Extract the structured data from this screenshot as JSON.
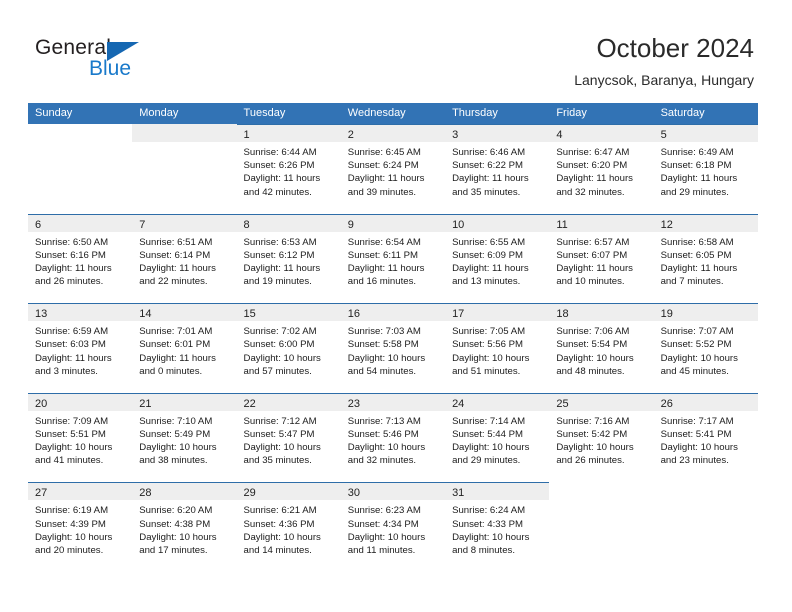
{
  "brand": {
    "name_part1": "General",
    "name_part2": "Blue",
    "color_dark": "#231f20",
    "color_blue": "#1979ca"
  },
  "header": {
    "title": "October 2024",
    "subtitle": "Lanycsok, Baranya, Hungary"
  },
  "theme": {
    "header_blue": "#3273b5",
    "separator_blue": "#2e6da8",
    "date_strip_gray": "#eeeeee"
  },
  "weekdays": [
    "Sunday",
    "Monday",
    "Tuesday",
    "Wednesday",
    "Thursday",
    "Friday",
    "Saturday"
  ],
  "weeks": [
    [
      {
        "day": "",
        "sunrise": "",
        "sunset": "",
        "daylight": "",
        "state": "blank"
      },
      {
        "day": "",
        "sunrise": "",
        "sunset": "",
        "daylight": "",
        "state": "empty"
      },
      {
        "day": "1",
        "sunrise": "Sunrise: 6:44 AM",
        "sunset": "Sunset: 6:26 PM",
        "daylight": "Daylight: 11 hours and 42 minutes.",
        "state": "filled"
      },
      {
        "day": "2",
        "sunrise": "Sunrise: 6:45 AM",
        "sunset": "Sunset: 6:24 PM",
        "daylight": "Daylight: 11 hours and 39 minutes.",
        "state": "filled"
      },
      {
        "day": "3",
        "sunrise": "Sunrise: 6:46 AM",
        "sunset": "Sunset: 6:22 PM",
        "daylight": "Daylight: 11 hours and 35 minutes.",
        "state": "filled"
      },
      {
        "day": "4",
        "sunrise": "Sunrise: 6:47 AM",
        "sunset": "Sunset: 6:20 PM",
        "daylight": "Daylight: 11 hours and 32 minutes.",
        "state": "filled"
      },
      {
        "day": "5",
        "sunrise": "Sunrise: 6:49 AM",
        "sunset": "Sunset: 6:18 PM",
        "daylight": "Daylight: 11 hours and 29 minutes.",
        "state": "filled"
      }
    ],
    [
      {
        "day": "6",
        "sunrise": "Sunrise: 6:50 AM",
        "sunset": "Sunset: 6:16 PM",
        "daylight": "Daylight: 11 hours and 26 minutes.",
        "state": "filled"
      },
      {
        "day": "7",
        "sunrise": "Sunrise: 6:51 AM",
        "sunset": "Sunset: 6:14 PM",
        "daylight": "Daylight: 11 hours and 22 minutes.",
        "state": "filled"
      },
      {
        "day": "8",
        "sunrise": "Sunrise: 6:53 AM",
        "sunset": "Sunset: 6:12 PM",
        "daylight": "Daylight: 11 hours and 19 minutes.",
        "state": "filled"
      },
      {
        "day": "9",
        "sunrise": "Sunrise: 6:54 AM",
        "sunset": "Sunset: 6:11 PM",
        "daylight": "Daylight: 11 hours and 16 minutes.",
        "state": "filled"
      },
      {
        "day": "10",
        "sunrise": "Sunrise: 6:55 AM",
        "sunset": "Sunset: 6:09 PM",
        "daylight": "Daylight: 11 hours and 13 minutes.",
        "state": "filled"
      },
      {
        "day": "11",
        "sunrise": "Sunrise: 6:57 AM",
        "sunset": "Sunset: 6:07 PM",
        "daylight": "Daylight: 11 hours and 10 minutes.",
        "state": "filled"
      },
      {
        "day": "12",
        "sunrise": "Sunrise: 6:58 AM",
        "sunset": "Sunset: 6:05 PM",
        "daylight": "Daylight: 11 hours and 7 minutes.",
        "state": "filled"
      }
    ],
    [
      {
        "day": "13",
        "sunrise": "Sunrise: 6:59 AM",
        "sunset": "Sunset: 6:03 PM",
        "daylight": "Daylight: 11 hours and 3 minutes.",
        "state": "filled"
      },
      {
        "day": "14",
        "sunrise": "Sunrise: 7:01 AM",
        "sunset": "Sunset: 6:01 PM",
        "daylight": "Daylight: 11 hours and 0 minutes.",
        "state": "filled"
      },
      {
        "day": "15",
        "sunrise": "Sunrise: 7:02 AM",
        "sunset": "Sunset: 6:00 PM",
        "daylight": "Daylight: 10 hours and 57 minutes.",
        "state": "filled"
      },
      {
        "day": "16",
        "sunrise": "Sunrise: 7:03 AM",
        "sunset": "Sunset: 5:58 PM",
        "daylight": "Daylight: 10 hours and 54 minutes.",
        "state": "filled"
      },
      {
        "day": "17",
        "sunrise": "Sunrise: 7:05 AM",
        "sunset": "Sunset: 5:56 PM",
        "daylight": "Daylight: 10 hours and 51 minutes.",
        "state": "filled"
      },
      {
        "day": "18",
        "sunrise": "Sunrise: 7:06 AM",
        "sunset": "Sunset: 5:54 PM",
        "daylight": "Daylight: 10 hours and 48 minutes.",
        "state": "filled"
      },
      {
        "day": "19",
        "sunrise": "Sunrise: 7:07 AM",
        "sunset": "Sunset: 5:52 PM",
        "daylight": "Daylight: 10 hours and 45 minutes.",
        "state": "filled"
      }
    ],
    [
      {
        "day": "20",
        "sunrise": "Sunrise: 7:09 AM",
        "sunset": "Sunset: 5:51 PM",
        "daylight": "Daylight: 10 hours and 41 minutes.",
        "state": "filled"
      },
      {
        "day": "21",
        "sunrise": "Sunrise: 7:10 AM",
        "sunset": "Sunset: 5:49 PM",
        "daylight": "Daylight: 10 hours and 38 minutes.",
        "state": "filled"
      },
      {
        "day": "22",
        "sunrise": "Sunrise: 7:12 AM",
        "sunset": "Sunset: 5:47 PM",
        "daylight": "Daylight: 10 hours and 35 minutes.",
        "state": "filled"
      },
      {
        "day": "23",
        "sunrise": "Sunrise: 7:13 AM",
        "sunset": "Sunset: 5:46 PM",
        "daylight": "Daylight: 10 hours and 32 minutes.",
        "state": "filled"
      },
      {
        "day": "24",
        "sunrise": "Sunrise: 7:14 AM",
        "sunset": "Sunset: 5:44 PM",
        "daylight": "Daylight: 10 hours and 29 minutes.",
        "state": "filled"
      },
      {
        "day": "25",
        "sunrise": "Sunrise: 7:16 AM",
        "sunset": "Sunset: 5:42 PM",
        "daylight": "Daylight: 10 hours and 26 minutes.",
        "state": "filled"
      },
      {
        "day": "26",
        "sunrise": "Sunrise: 7:17 AM",
        "sunset": "Sunset: 5:41 PM",
        "daylight": "Daylight: 10 hours and 23 minutes.",
        "state": "filled"
      }
    ],
    [
      {
        "day": "27",
        "sunrise": "Sunrise: 6:19 AM",
        "sunset": "Sunset: 4:39 PM",
        "daylight": "Daylight: 10 hours and 20 minutes.",
        "state": "filled"
      },
      {
        "day": "28",
        "sunrise": "Sunrise: 6:20 AM",
        "sunset": "Sunset: 4:38 PM",
        "daylight": "Daylight: 10 hours and 17 minutes.",
        "state": "filled"
      },
      {
        "day": "29",
        "sunrise": "Sunrise: 6:21 AM",
        "sunset": "Sunset: 4:36 PM",
        "daylight": "Daylight: 10 hours and 14 minutes.",
        "state": "filled"
      },
      {
        "day": "30",
        "sunrise": "Sunrise: 6:23 AM",
        "sunset": "Sunset: 4:34 PM",
        "daylight": "Daylight: 10 hours and 11 minutes.",
        "state": "filled"
      },
      {
        "day": "31",
        "sunrise": "Sunrise: 6:24 AM",
        "sunset": "Sunset: 4:33 PM",
        "daylight": "Daylight: 10 hours and 8 minutes.",
        "state": "filled"
      },
      {
        "day": "",
        "sunrise": "",
        "sunset": "",
        "daylight": "",
        "state": "blank"
      },
      {
        "day": "",
        "sunrise": "",
        "sunset": "",
        "daylight": "",
        "state": "blank"
      }
    ]
  ]
}
